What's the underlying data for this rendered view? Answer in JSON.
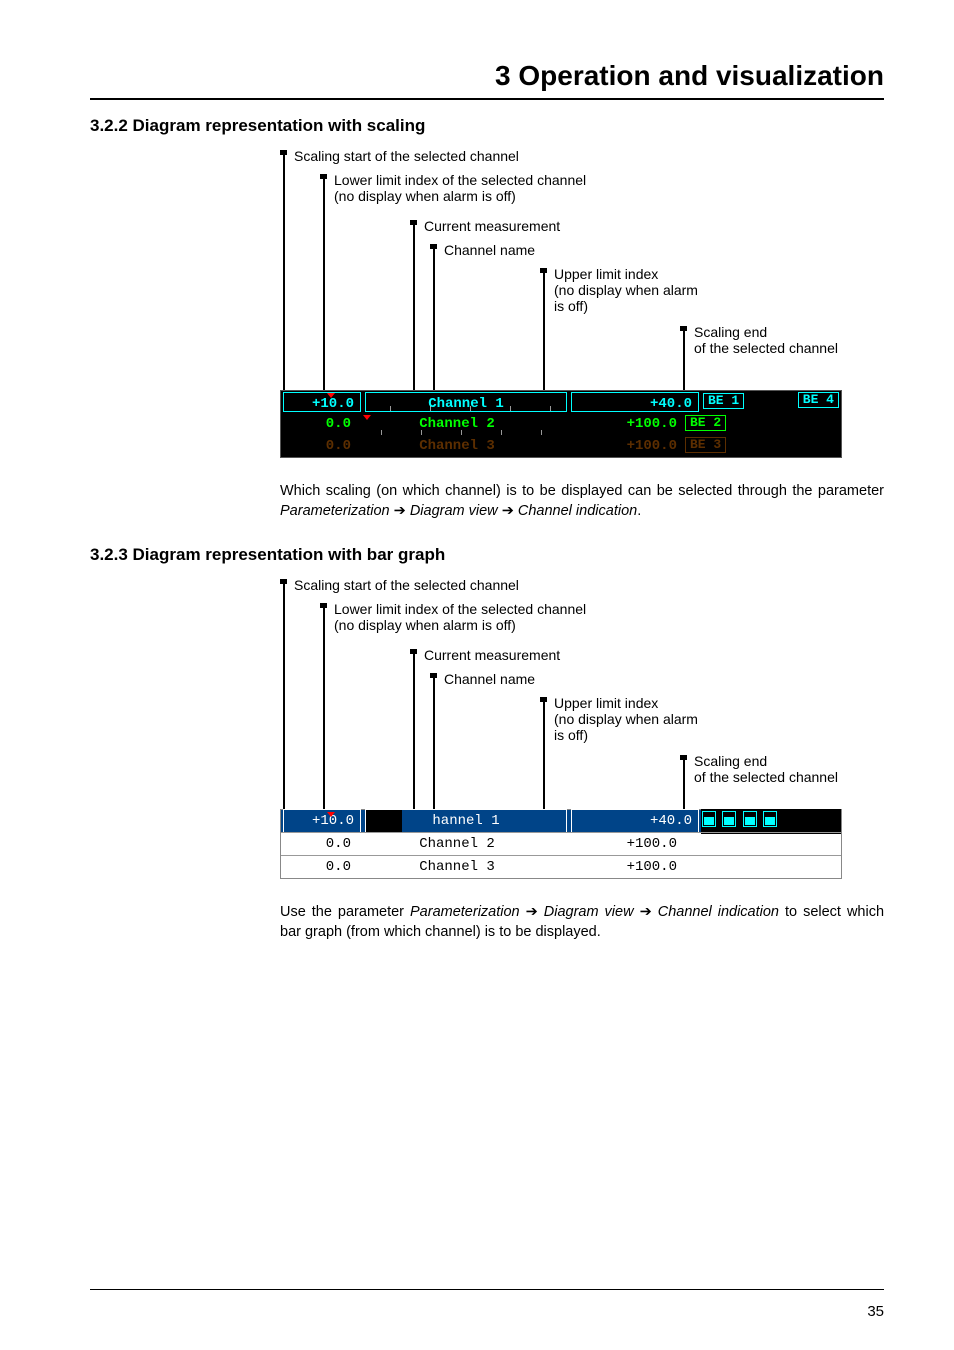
{
  "chapter_title": "3 Operation and visualization",
  "sections": {
    "s322": {
      "heading": "3.2.2 Diagram representation with scaling"
    },
    "s323": {
      "heading": "3.2.3 Diagram representation with bar graph"
    }
  },
  "callouts": {
    "scaling_start": "Scaling start of the selected channel",
    "lower_limit_l1": "Lower limit index of the selected channel",
    "lower_limit_l2": "(no display when alarm is off)",
    "current_meas": "Current measurement",
    "channel_name": "Channel name",
    "upper_limit_l1": "Upper limit index",
    "upper_limit_l2": "(no display when alarm",
    "upper_limit_l3": "is off)",
    "scaling_end_l1": "Scaling end",
    "scaling_end_l2": "of the selected channel"
  },
  "screen1": {
    "rows": [
      {
        "left": "+10.0",
        "mid": "Channel 1",
        "right": "+40.0",
        "color": "#0ff"
      },
      {
        "left": "0.0",
        "mid": "Channel 2",
        "right": "+100.0",
        "color": "#0f0"
      },
      {
        "left": "0.0",
        "mid": "Channel 3",
        "right": "+100.0",
        "color": "#c60"
      }
    ],
    "be": {
      "b1": "BE 1",
      "b2": "BE 2",
      "b3": "BE 3",
      "b4": "BE 4"
    }
  },
  "para1_a": "Which scaling (on which channel) is to be displayed can be selected through the parameter ",
  "para1_b": "Parameterization",
  "para1_c": "Diagram view",
  "para1_d": "Channel indication",
  "para2_a": "Use the parameter ",
  "para2_b": "Parameterization",
  "para2_c": "Diagram view",
  "para2_d": "Channel indication",
  "para2_e": " to select which bar graph (from which channel) is to be displayed.",
  "screen2": {
    "rows": [
      {
        "left": "+10.0",
        "mid": "hannel 1",
        "right": "+40.0",
        "highlight": true
      },
      {
        "left": "0.0",
        "mid": "Channel 2",
        "right": "+100.0",
        "highlight": false
      },
      {
        "left": "0.0",
        "mid": "Channel 3",
        "right": "+100.0",
        "highlight": false
      }
    ]
  },
  "arrow": "➔",
  "page_number": "35"
}
